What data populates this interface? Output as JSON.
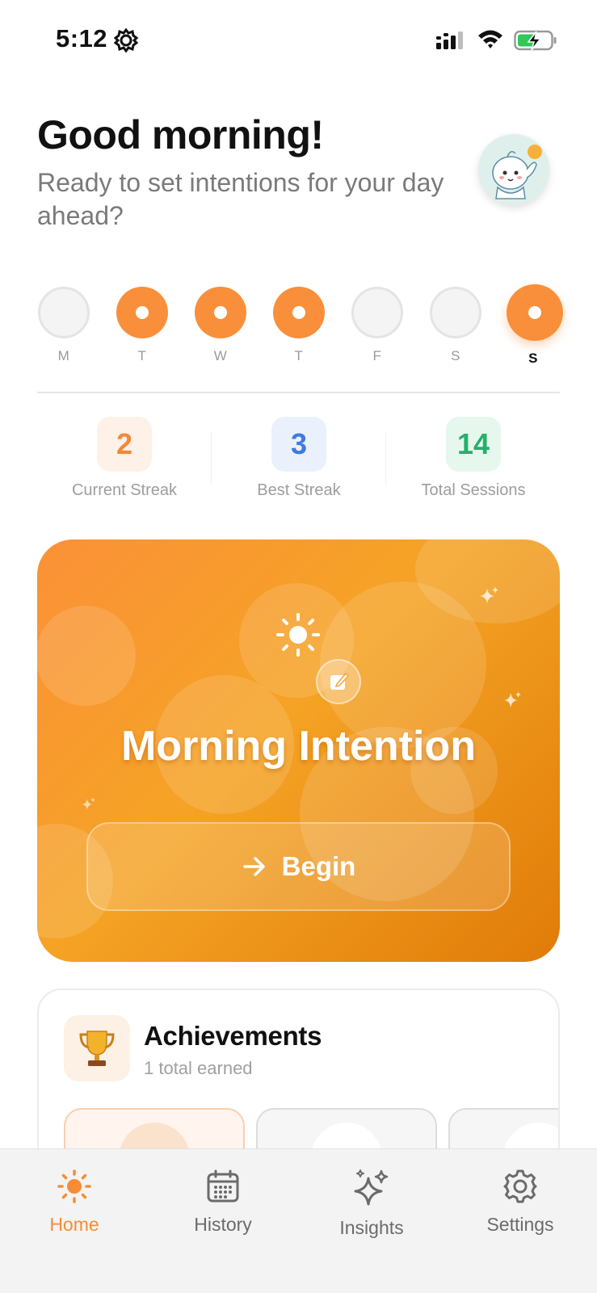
{
  "status_bar": {
    "time": "5:12"
  },
  "header": {
    "greeting": "Good morning!",
    "subtitle": "Ready to set intentions for your day ahead?"
  },
  "week": {
    "days": [
      {
        "label": "M",
        "done": false,
        "today": false
      },
      {
        "label": "T",
        "done": true,
        "today": false
      },
      {
        "label": "W",
        "done": true,
        "today": false
      },
      {
        "label": "T",
        "done": true,
        "today": false
      },
      {
        "label": "F",
        "done": false,
        "today": false
      },
      {
        "label": "S",
        "done": false,
        "today": false
      },
      {
        "label": "S",
        "done": true,
        "today": true
      }
    ]
  },
  "stats": [
    {
      "value": "2",
      "label": "Current Streak",
      "color": "#f2893a",
      "bg": "#fdf1e8"
    },
    {
      "value": "3",
      "label": "Best Streak",
      "color": "#3f7ae0",
      "bg": "#eaf1fd"
    },
    {
      "value": "14",
      "label": "Total Sessions",
      "color": "#26b06b",
      "bg": "#e6f7ee"
    }
  ],
  "hero": {
    "title": "Morning Intention",
    "button_label": "Begin"
  },
  "achievements": {
    "title": "Achievements",
    "subtitle": "1 total earned"
  },
  "tabbar": {
    "tabs": [
      {
        "label": "Home",
        "icon": "sun-icon",
        "active": true
      },
      {
        "label": "History",
        "icon": "calendar-icon",
        "active": false
      },
      {
        "label": "Insights",
        "icon": "sparkles-icon",
        "active": false
      },
      {
        "label": "Settings",
        "icon": "gear-icon",
        "active": false
      }
    ]
  },
  "colors": {
    "accent": "#f68d35"
  }
}
